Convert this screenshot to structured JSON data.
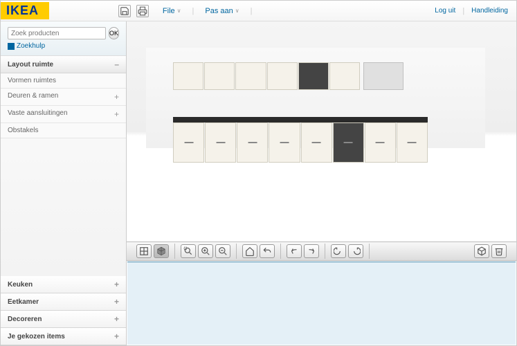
{
  "header": {
    "logo": "IKEA",
    "menu": {
      "file": "File",
      "fit": "Pas aan"
    },
    "right": {
      "logout": "Log uit",
      "manual": "Handleiding"
    }
  },
  "search": {
    "placeholder": "Zoek producten",
    "ok": "OK",
    "help": "Zoekhulp"
  },
  "accordion": {
    "layout": {
      "title": "Layout ruimte"
    },
    "sub": {
      "shapes": "Vormen ruimtes",
      "doors": "Deuren & ramen",
      "fixtures": "Vaste aansluitingen",
      "obstacles": "Obstakels"
    },
    "bottom": {
      "kitchen": "Keuken",
      "dining": "Eetkamer",
      "decorate": "Decoreren",
      "chosen": "Je gekozen items"
    }
  },
  "icons": {
    "save": "save-icon",
    "print": "print-icon",
    "view2d": "grid-icon",
    "view3d": "cube-icon",
    "zoomBox": "zoom-region-icon",
    "zoomIn": "zoom-in-icon",
    "zoomOut": "zoom-out-icon",
    "home": "home-icon",
    "undo": "undo-icon",
    "panL": "pan-left-icon",
    "panR": "pan-right-icon",
    "rotL": "rotate-left-icon",
    "rotR": "rotate-right-icon",
    "box": "package-icon",
    "trash": "trash-icon"
  }
}
